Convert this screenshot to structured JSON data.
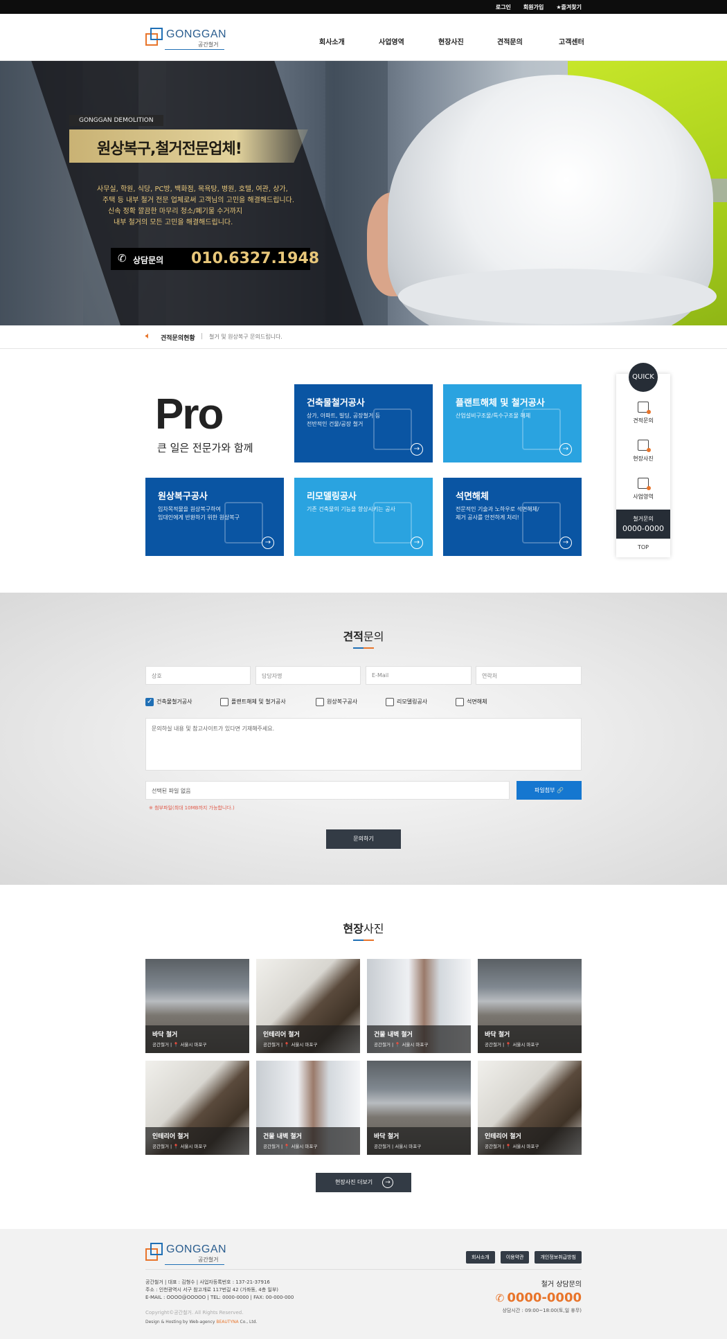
{
  "topbar": {
    "links": [
      "로그인",
      "회원가입",
      "★즐겨찾기"
    ]
  },
  "brand": {
    "name": "GONGGAN",
    "sub": "공간철거"
  },
  "nav": [
    "회사소개",
    "사업영역",
    "현장사진",
    "견적문의",
    "고객센터"
  ],
  "hero": {
    "tag": "GONGGAN DEMOLITION",
    "headline": "원상복구,철거전문업체!",
    "desc": [
      "사무실, 학원, 식당, PC방, 백화점, 목욕탕, 병원, 호텔, 여관, 상가,",
      "주택 등 내부 철거 전문 업체로써 고객님의 고민을 해결해드립니다.",
      "신속 정확 깔끔한 마무리 청소/폐기물 수거까지",
      "내부 철거의 모든 고민을 해결해드립니다."
    ],
    "call_label": "상담문의",
    "call_number": "010.6327.1948"
  },
  "notice": {
    "title": "견적문의현황",
    "separator": "|",
    "text": "철거 및 원상복구 문의드립니다."
  },
  "pro": {
    "title": "Pro",
    "subtitle": "큰 일은 전문가와 함께"
  },
  "services": [
    {
      "title": "건축물철거공사",
      "desc": "상가, 아파트, 빌딩, 공장철거 등\n전반적인 건물/공장 철거"
    },
    {
      "title": "플랜트해체 및 철거공사",
      "desc": "산업설비구조물/특수구조물 해체"
    },
    {
      "title": "원상복구공사",
      "desc": "임차목적물을 원상복구하여\n임대인에게 반환하기 위한 원상복구"
    },
    {
      "title": "리모델링공사",
      "desc": "기존 건축물의 기능을 향상시키는 공사"
    },
    {
      "title": "석면해체",
      "desc": "전문적인 기술과 노하우로 석면해체/\n제거 공사를 안전하게 처리!"
    }
  ],
  "quick": {
    "title": "QUICK",
    "items": [
      "견적문의",
      "현장사진",
      "사업영역"
    ],
    "contact_label": "철거문의",
    "contact_number": "0000-0000",
    "top": "TOP"
  },
  "inquiry": {
    "title_bold": "견적",
    "title_rest": "문의",
    "placeholders": [
      "상호",
      "담당자명",
      "E-Mail",
      "연락처"
    ],
    "checks": [
      {
        "label": "건축물철거공사",
        "checked": true
      },
      {
        "label": "플랜트해체 및 철거공사",
        "checked": false
      },
      {
        "label": "원상복구공사",
        "checked": false
      },
      {
        "label": "리모델링공사",
        "checked": false
      },
      {
        "label": "석면해체",
        "checked": false
      }
    ],
    "textarea": "문의하실 내용 및 참고사이트가 있다면 기재해주세요.",
    "file_text": "선택된 파일 없음",
    "file_button": "파일첨부 🔗",
    "file_note": "※ 첨부파일(최대 10MB까지 가능합니다.)",
    "submit": "문의하기"
  },
  "gallery": {
    "title_bold": "현장",
    "title_rest": "사진",
    "items": [
      {
        "title": "바닥 철거",
        "meta": "공간철거  |  📍 서울시 마포구",
        "img": "p-floor"
      },
      {
        "title": "인테리어 철거",
        "meta": "공간철거  |  📍 서울시 마포구",
        "img": "p-int"
      },
      {
        "title": "건물 내벽 철거",
        "meta": "공간철거  |  📍 서울시 마포구",
        "img": "p-wall"
      },
      {
        "title": "바닥 철거",
        "meta": "공간철거  |  📍 서울시 마포구",
        "img": "p-floor"
      },
      {
        "title": "인테리어 철거",
        "meta": "공간철거  |  📍 서울시 마포구",
        "img": "p-int"
      },
      {
        "title": "건물 내벽 철거",
        "meta": "공간철거  |  📍 서울시 마포구",
        "img": "p-wall"
      },
      {
        "title": "바닥 철거",
        "meta": "공간철거  |  서울시 마포구",
        "img": "p-floor"
      },
      {
        "title": "인테리어 철거",
        "meta": "공간철거  |  📍 서울시 마포구",
        "img": "p-int"
      }
    ],
    "more": "현장사진 더보기"
  },
  "footer": {
    "buttons": [
      "회사소개",
      "이용약관",
      "개인정보취급방침"
    ],
    "info": [
      "공간철거  |  대표 : 김형수  |  사업자등록번호 : 137-21-37916",
      "주소 : 인천광역시 서구 참고개로 117번길 42 (가좌동, 4층 일부)",
      "E-MAIL : OOOO@OOOOO  |  TEL: 0000-0000  |  FAX: 00-000-000"
    ],
    "copyright": "Copyright©공간철거. All Rights Reserved.",
    "design_prefix": "Design & Hosting by Web-agency ",
    "design_brand": "BEAUTYNA",
    "design_suffix": " Co., Ltd.",
    "consult_label": "철거 상담문의",
    "consult_number": "0000-0000",
    "hours": "상담시간 : 09:00~18:00(토,일 휴무)"
  },
  "colors": {
    "dark_blue": "#0a55a3",
    "light_blue": "#2aa3e0",
    "orange": "#e8742a",
    "gold": "#e8c77a",
    "navy": "#333b45"
  }
}
